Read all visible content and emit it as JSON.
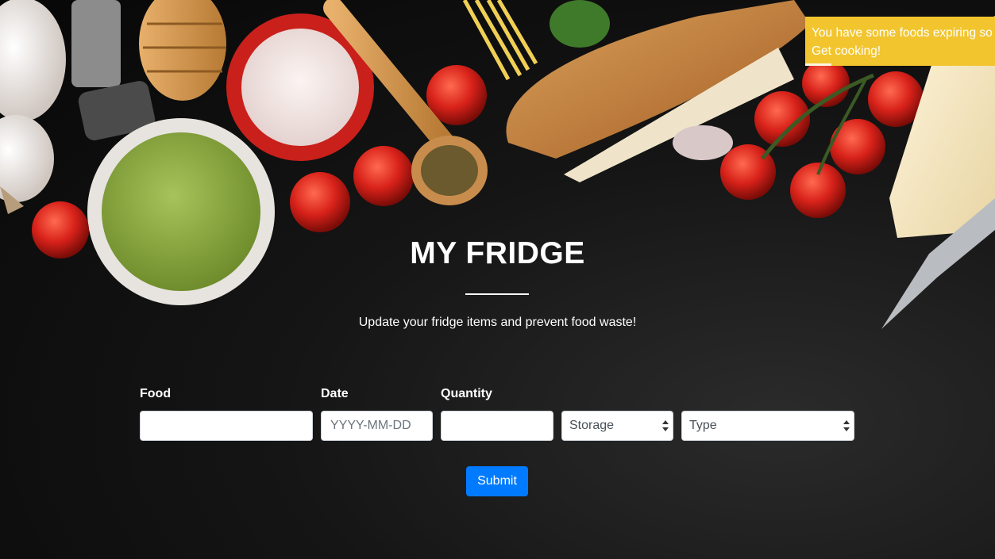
{
  "colors": {
    "toast": "#f2c52f",
    "submit": "#007bff",
    "background": "#0b0b0b"
  },
  "toast": {
    "line1": "You have some foods expiring so",
    "line2": "Get cooking!",
    "progress": 0.14
  },
  "header": {
    "title": "MY FRIDGE",
    "subtitle": "Update your fridge items and prevent food waste!"
  },
  "form": {
    "food_label": "Food",
    "food_value": "",
    "date_label": "Date",
    "date_placeholder": "YYYY-MM-DD",
    "quantity_label": "Quantity",
    "quantity_value": "",
    "storage_selected": "Storage",
    "type_selected": "Type",
    "submit_label": "Submit"
  }
}
